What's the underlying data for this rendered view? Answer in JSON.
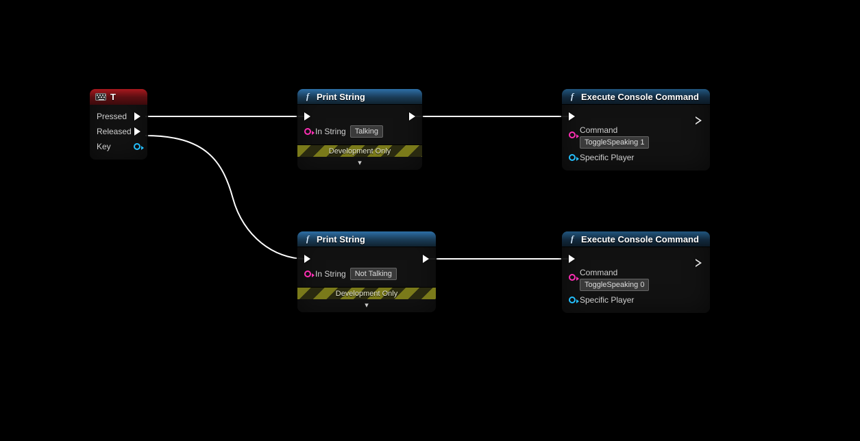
{
  "input_node": {
    "title": "T",
    "pressed_label": "Pressed",
    "released_label": "Released",
    "key_label": "Key"
  },
  "print1": {
    "title": "Print String",
    "in_string_label": "In String",
    "in_string_value": "Talking",
    "dev_label": "Development Only"
  },
  "print2": {
    "title": "Print String",
    "in_string_label": "In String",
    "in_string_value": "Not Talking",
    "dev_label": "Development Only"
  },
  "exec1": {
    "title": "Execute Console Command",
    "command_label": "Command",
    "command_value": "ToggleSpeaking 1",
    "player_label": "Specific Player"
  },
  "exec2": {
    "title": "Execute Console Command",
    "command_label": "Command",
    "command_value": "ToggleSpeaking 0",
    "player_label": "Specific Player"
  }
}
